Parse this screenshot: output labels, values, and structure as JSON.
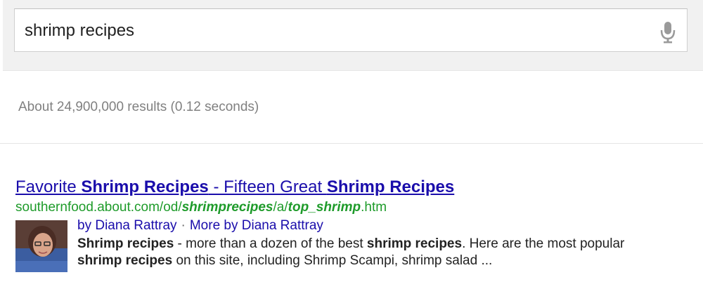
{
  "search": {
    "query": "shrimp recipes"
  },
  "stats": {
    "text": "About 24,900,000 results (0.12 seconds)"
  },
  "result": {
    "title": {
      "t1": "Favorite ",
      "t2": "Shrimp Recipes",
      "t3": " - Fifteen Great ",
      "t4": "Shrimp Recipes"
    },
    "url": {
      "u1": "southernfood.about.com/od/",
      "u2": "shrimprecipes",
      "u3": "/a/",
      "u4": "top_shrimp",
      "u5": ".htm"
    },
    "author": {
      "by_label": "by Diana Rattray",
      "separator": "·",
      "more_label": "More by Diana Rattray"
    },
    "snippet": {
      "s1": "Shrimp recipes",
      "s2": " - more than a dozen of the best ",
      "s3": "shrimp recipes",
      "s4": ". Here are the most popular ",
      "s5": "shrimp recipes",
      "s6": " on this site, including Shrimp Scampi, shrimp salad ..."
    }
  },
  "icons": {
    "mic": "microphone-icon",
    "photo": "author-photo"
  },
  "colors": {
    "link": "#1a0dab",
    "url": "#1e9b2a",
    "stats": "#808080",
    "text": "#222222"
  }
}
